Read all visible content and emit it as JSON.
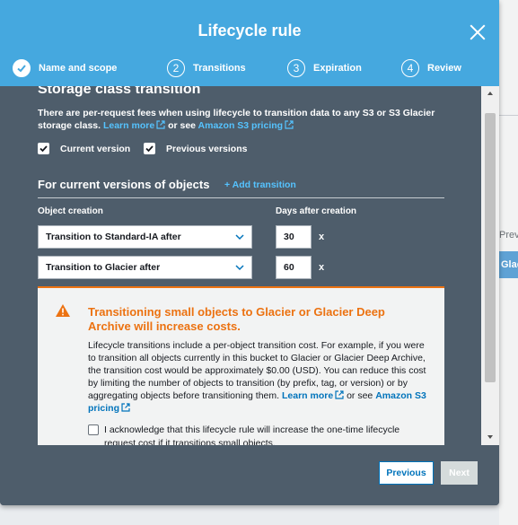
{
  "modal": {
    "title": "Lifecycle rule"
  },
  "steps": [
    {
      "num": "",
      "label": "Name and scope",
      "state": "complete"
    },
    {
      "num": "2",
      "label": "Transitions",
      "state": "current"
    },
    {
      "num": "3",
      "label": "Expiration",
      "state": "pending"
    },
    {
      "num": "4",
      "label": "Review",
      "state": "pending"
    }
  ],
  "section": {
    "title": "Storage class transition",
    "intro": "There are per-request fees when using lifecycle to transition data to any S3 or S3 Glacier storage class.",
    "learn_more": "Learn more",
    "or_see": "or see",
    "pricing_link": "Amazon S3 pricing"
  },
  "versions": {
    "current": {
      "label": "Current version",
      "checked": true
    },
    "previous": {
      "label": "Previous versions",
      "checked": true
    }
  },
  "current_versions": {
    "heading": "For current versions of objects",
    "add_transition": "+ Add transition",
    "col_object_creation": "Object creation",
    "col_days": "Days after creation",
    "rows": [
      {
        "transition": "Transition to Standard-IA after",
        "days": "30",
        "unit": "x"
      },
      {
        "transition": "Transition to Glacier after",
        "days": "60",
        "unit": "x"
      }
    ]
  },
  "warning": {
    "title": "Transitioning small objects to Glacier or Glacier Deep Archive will increase costs.",
    "body": "Lifecycle transitions include a per-object transition cost. For example, if you were to transition all objects currently in this bucket to Glacier or Glacier Deep Archive, the transition cost would be approximately $0.00 (USD). You can reduce this cost by limiting the number of objects to transition (by prefix, tag, or version) or by aggregating objects before transitioning them.",
    "learn_more": "Learn more",
    "or_see": "or see",
    "pricing_link": "Amazon S3 pricing",
    "acknowledge": "I acknowledge that this lifecycle rule will increase the one-time lifecycle request cost if it transitions small objects."
  },
  "footer": {
    "previous": "Previous",
    "next": "Next"
  },
  "background": {
    "text1": "Previou",
    "button": "Glac"
  },
  "colors": {
    "header": "#45a8df",
    "body": "#4e5d6b",
    "link": "#55c3ff",
    "warning": "#ec7211",
    "aws_link": "#0073bb"
  }
}
